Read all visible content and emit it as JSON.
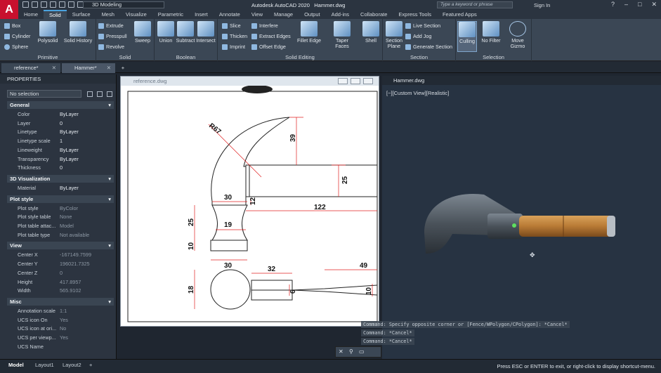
{
  "app": {
    "logo": "A",
    "title": "Autodesk AutoCAD 2020",
    "file": "Hammer.dwg",
    "workspace": "3D Modeling",
    "search_placeholder": "Type a keyword or phrase",
    "signin": "Sign In"
  },
  "ribbon_tabs": [
    "Home",
    "Solid",
    "Surface",
    "Mesh",
    "Visualize",
    "Parametric",
    "Insert",
    "Annotate",
    "View",
    "Manage",
    "Output",
    "Add-ins",
    "Collaborate",
    "Express Tools",
    "Featured Apps"
  ],
  "ribbon": {
    "primitive": {
      "title": "Primitive",
      "small": [
        "Box",
        "Cylinder",
        "Sphere"
      ],
      "big": [
        "Polysolid",
        "Solid History"
      ]
    },
    "solid": {
      "title": "Solid",
      "small": [
        "Extrude",
        "Presspull",
        "Revolve"
      ],
      "big": [
        "Sweep"
      ]
    },
    "boolean": {
      "title": "Boolean",
      "big": [
        "Union",
        "Subtract",
        "Intersect"
      ]
    },
    "editing": {
      "title": "Solid Editing",
      "small": [
        "Slice",
        "Thicken",
        "Imprint",
        "Interfere",
        "Extract Edges",
        "Offset Edge"
      ],
      "big": [
        "Fillet Edge",
        "Taper Faces",
        "Shell"
      ]
    },
    "section": {
      "title": "Section",
      "big": [
        "Section Plane"
      ],
      "small": [
        "Live Section",
        "Add Jog",
        "Generate Section"
      ]
    },
    "selection": {
      "title": "Selection",
      "big": [
        "Culling",
        "No Filter",
        "Move Gizmo"
      ]
    }
  },
  "doc_tabs": [
    "reference*",
    "Hammer*"
  ],
  "properties": {
    "title": "PROPERTIES",
    "selection": "No selection",
    "sections": [
      {
        "name": "General",
        "rows": [
          [
            "Color",
            "ByLayer"
          ],
          [
            "Layer",
            "0"
          ],
          [
            "Linetype",
            "ByLayer"
          ],
          [
            "Linetype scale",
            "1"
          ],
          [
            "Lineweight",
            "ByLayer"
          ],
          [
            "Transparency",
            "ByLayer"
          ],
          [
            "Thickness",
            "0"
          ]
        ]
      },
      {
        "name": "3D Visualization",
        "rows": [
          [
            "Material",
            "ByLayer"
          ]
        ]
      },
      {
        "name": "Plot style",
        "rows": [
          [
            "Plot style",
            "ByColor"
          ],
          [
            "Plot style table",
            "None"
          ],
          [
            "Plot table attac...",
            "Model"
          ],
          [
            "Plot table type",
            "Not available"
          ]
        ]
      },
      {
        "name": "View",
        "rows": [
          [
            "Center X",
            "-167149.7599"
          ],
          [
            "Center Y",
            "196021.7325"
          ],
          [
            "Center Z",
            "0"
          ],
          [
            "Height",
            "417.8957"
          ],
          [
            "Width",
            "565.9102"
          ]
        ]
      },
      {
        "name": "Misc",
        "rows": [
          [
            "Annotation scale",
            "1:1"
          ],
          [
            "UCS icon On",
            "Yes"
          ],
          [
            "UCS icon at ori...",
            "No"
          ],
          [
            "UCS per viewp...",
            "Yes"
          ],
          [
            "UCS Name",
            ""
          ]
        ]
      }
    ]
  },
  "viewport_left": {
    "title": "reference.dwg",
    "dims": {
      "r": "R67",
      "d39": "39",
      "d25a": "25",
      "d30a": "30",
      "d12": "12",
      "d122": "122",
      "d25b": "25",
      "d19": "19",
      "d10a": "10",
      "d30b": "30",
      "d32": "32",
      "d49": "49",
      "d18": "18",
      "d6": "6",
      "d10b": "10"
    }
  },
  "viewport_right": {
    "title": "Hammer.dwg",
    "label": "[−][Custom View][Realistic]"
  },
  "command": {
    "line1": "Command: Specify opposite corner or [Fence/WPolygon/CPolygon]: *Cancel*",
    "line2": "Command: *Cancel*",
    "line3": "Command: *Cancel*"
  },
  "status": {
    "tabs": [
      "Model",
      "Layout1",
      "Layout2"
    ],
    "message": "Press ESC or ENTER to exit, or right-click to display shortcut-menu."
  }
}
